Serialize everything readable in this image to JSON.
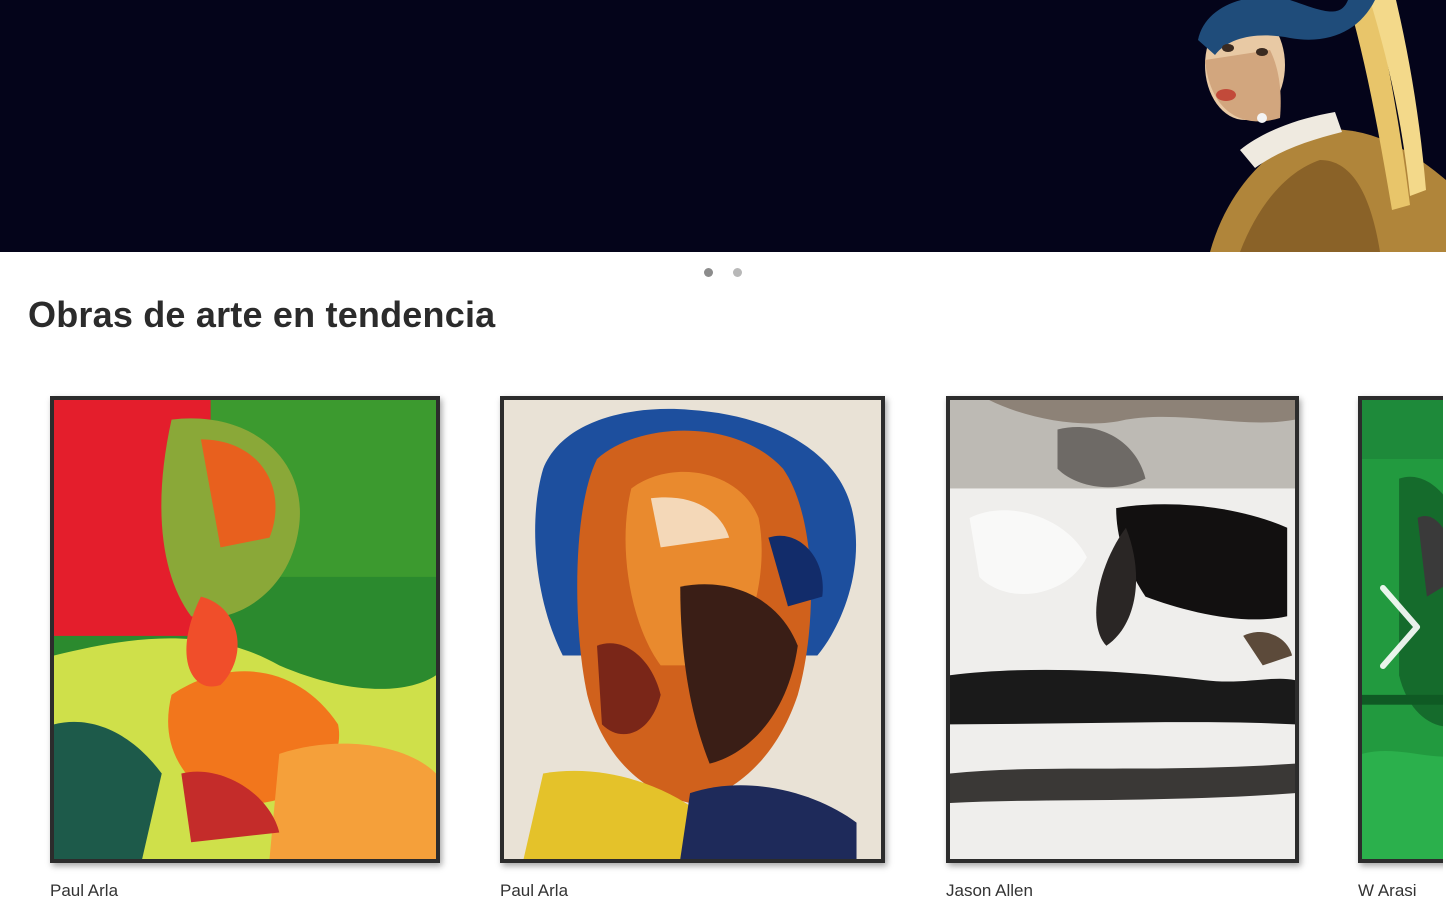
{
  "hero": {
    "background_color": "#04041a",
    "slide_count": 2,
    "active_slide": 1
  },
  "trending": {
    "title": "Obras de arte en tendencia",
    "artworks": [
      {
        "artist": "Paul Arla",
        "palette": [
          "#e8202b",
          "#3aa63a",
          "#f08a1a"
        ]
      },
      {
        "artist": "Paul Arla",
        "palette": [
          "#1f4fa8",
          "#d65a16",
          "#efe8dc"
        ]
      },
      {
        "artist": "Jason Allen",
        "palette": [
          "#f2f2f2",
          "#111111",
          "#8a8a8a"
        ]
      },
      {
        "artist": "W Arasi",
        "palette": [
          "#1c8c3c",
          "#2fb050",
          "#0e5a24"
        ]
      }
    ],
    "next_icon": "chevron-right-icon"
  }
}
